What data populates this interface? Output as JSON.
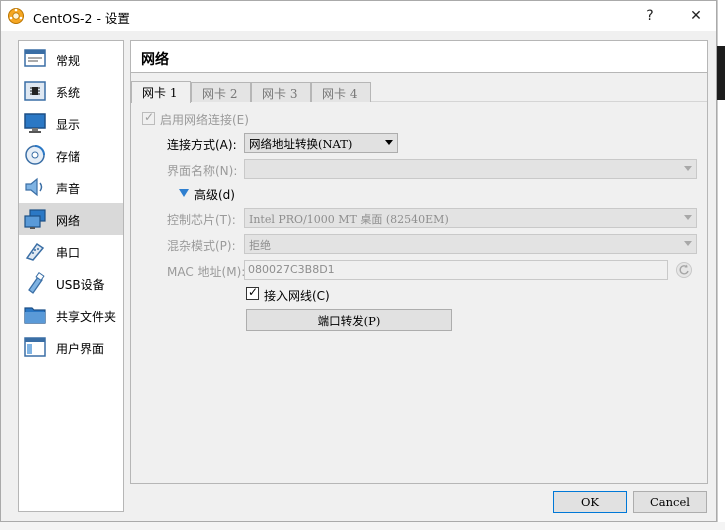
{
  "window": {
    "title": "CentOS-2 - 设置",
    "help_label": "?",
    "close_label": "✕"
  },
  "sidebar": {
    "items": [
      {
        "label": "常规",
        "icon": "general-icon"
      },
      {
        "label": "系统",
        "icon": "system-icon"
      },
      {
        "label": "显示",
        "icon": "display-icon"
      },
      {
        "label": "存储",
        "icon": "storage-icon"
      },
      {
        "label": "声音",
        "icon": "audio-icon"
      },
      {
        "label": "网络",
        "icon": "network-icon",
        "selected": true
      },
      {
        "label": "串口",
        "icon": "serial-port-icon"
      },
      {
        "label": "USB设备",
        "icon": "usb-icon"
      },
      {
        "label": "共享文件夹",
        "icon": "shared-folder-icon"
      },
      {
        "label": "用户界面",
        "icon": "user-interface-icon"
      }
    ]
  },
  "panel": {
    "title": "网络",
    "tabs": [
      {
        "label": "网卡 1",
        "active": true
      },
      {
        "label": "网卡 2"
      },
      {
        "label": "网卡 3"
      },
      {
        "label": "网卡 4"
      }
    ]
  },
  "form": {
    "enable_adapter": {
      "label": "启用网络连接(E)",
      "checked": true,
      "disabled": true
    },
    "attached_to": {
      "label": "连接方式(A):",
      "value": "网络地址转换(NAT)"
    },
    "name": {
      "label": "界面名称(N):",
      "value": ""
    },
    "advanced": {
      "label": "高级(d)"
    },
    "adapter_type": {
      "label": "控制芯片(T):",
      "value": "Intel PRO/1000 MT 桌面 (82540EM)"
    },
    "promiscuous": {
      "label": "混杂模式(P):",
      "value": "拒绝"
    },
    "mac": {
      "label": "MAC 地址(M):",
      "value": "080027C3B8D1"
    },
    "cable": {
      "label": "接入网线(C)",
      "checked": true
    },
    "port_forwarding": {
      "label": "端口转发(P)"
    }
  },
  "footer": {
    "ok_label": "OK",
    "cancel_label": "Cancel"
  },
  "colors": {
    "accent": "#0078d7",
    "selected_bg": "#d9d9d9",
    "disclosure": "#2e7fd0"
  }
}
